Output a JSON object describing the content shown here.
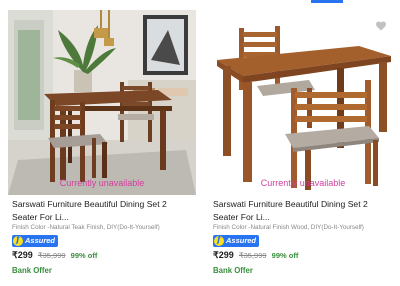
{
  "products": [
    {
      "status": "Currently unavailable",
      "title": "Sarswati Furniture Beautiful Dining Set 2 Seater For Li...",
      "description": "Finish Color -Natural Teak Finish, DIY(Do-It-Yourself)",
      "assured_label": "Assured",
      "price": "₹299",
      "mrp": "₹35,999",
      "discount": "99% off",
      "offer": "Bank Offer"
    },
    {
      "status": "Currently unavailable",
      "title": "Sarswati Furniture Beautiful Dining Set 2 Seater For Li...",
      "description": "Finish Color -Natural Finish Wood, DIY(Do-It-Yourself)",
      "assured_label": "Assured",
      "price": "₹299",
      "mrp": "₹35,999",
      "discount": "99% off",
      "offer": "Bank Offer"
    }
  ],
  "icons": {
    "wishlist": "heart-icon",
    "assured": "flipkart-assured-icon"
  },
  "colors": {
    "unavailable": "#d23f9e",
    "discount": "#388e3c",
    "assured_badge": "#2874f0",
    "muted": "#878787"
  }
}
